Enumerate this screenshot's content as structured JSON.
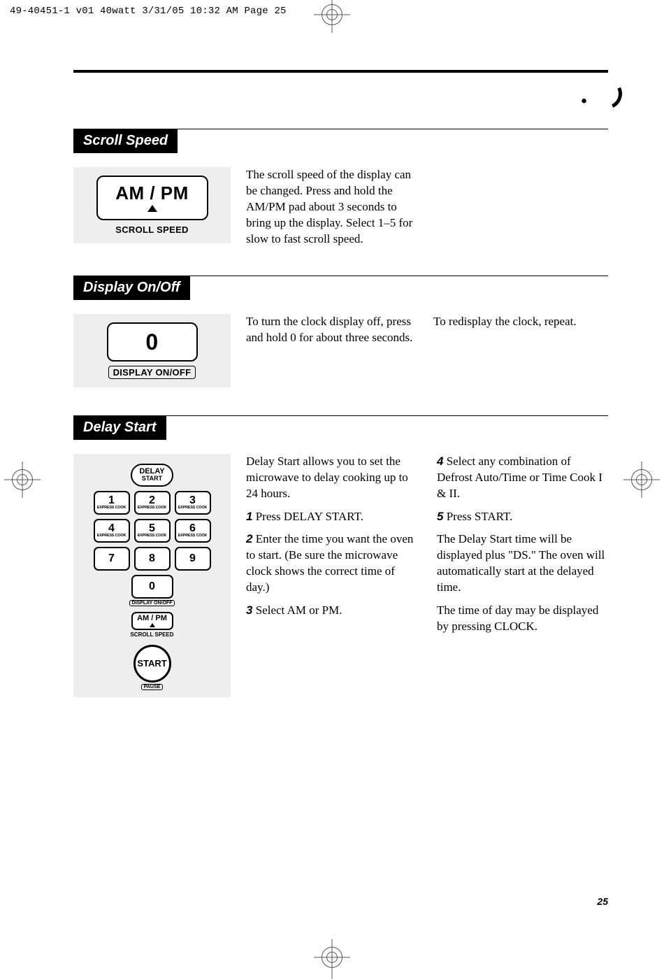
{
  "print_header": "49-40451-1 v01 40watt  3/31/05  10:32 AM  Page 25",
  "page_number": "25",
  "sections": {
    "scroll": {
      "heading": "Scroll Speed",
      "button_main": "AM / PM",
      "button_caption": "SCROLL SPEED",
      "para": "The scroll speed of the display can be changed. Press and hold the AM/PM pad about 3 seconds to bring up the display. Select 1–5 for slow to fast scroll speed."
    },
    "display": {
      "heading": "Display On/Off",
      "button_main": "0",
      "button_caption": "DISPLAY ON/OFF",
      "para_left": "To turn the clock display off, press and hold 0 for about three seconds.",
      "para_right": "To redisplay the clock, repeat."
    },
    "delay": {
      "heading": "Delay Start",
      "pill_delay_l1": "DELAY",
      "pill_delay_l2": "START",
      "key_express": "EXPRESS COOK",
      "keys": [
        "1",
        "2",
        "3",
        "4",
        "5",
        "6",
        "7",
        "8",
        "9",
        "0"
      ],
      "cap_display": "DISPLAY ON/OFF",
      "pill_ampm": "AM / PM",
      "cap_scroll": "SCROLL SPEED",
      "circle_start": "START",
      "cap_pause": "PAUSE",
      "intro": "Delay Start allows you to set the microwave to delay cooking up to 24 hours.",
      "steps": {
        "1": "Press DELAY START.",
        "2": "Enter the time you want the oven to start. (Be sure the microwave clock shows the correct time of day.)",
        "3": "Select AM or PM.",
        "4": "Select any combination of Defrost Auto/Time or Time Cook I & II.",
        "5": "Press START."
      },
      "tail1": "The Delay Start time will be displayed plus \"DS.\" The oven will automatically start at the delayed time.",
      "tail2": "The time of day may be displayed by pressing CLOCK."
    }
  }
}
